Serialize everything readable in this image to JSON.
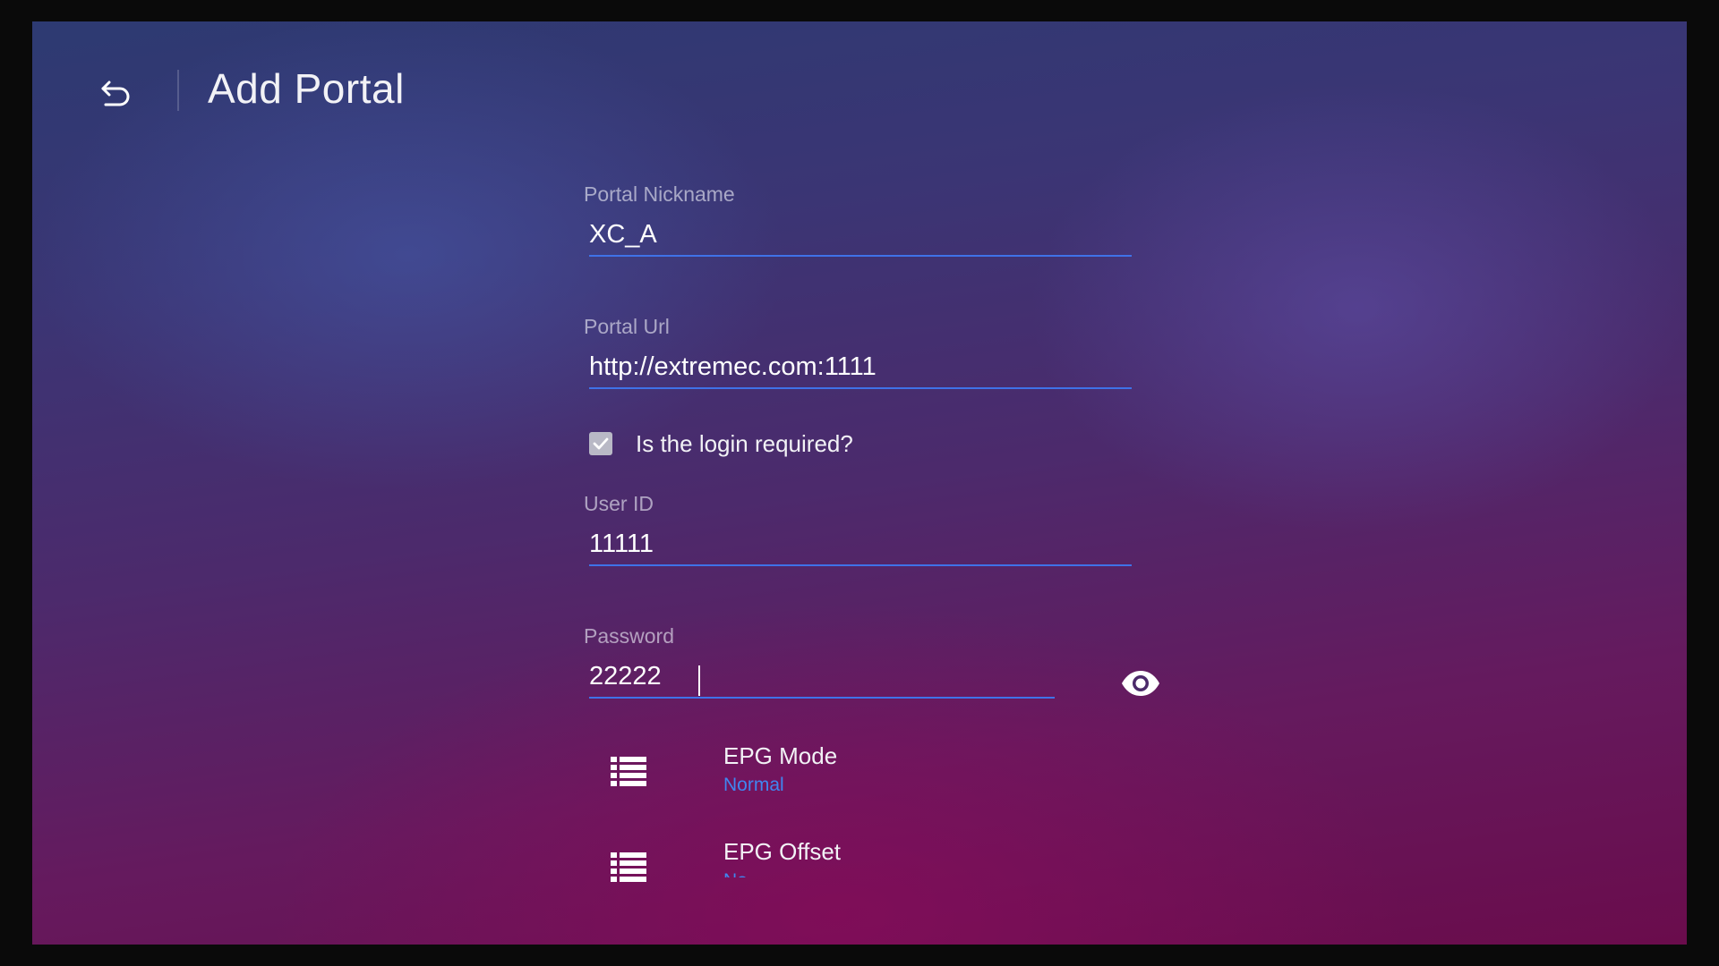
{
  "header": {
    "title": "Add Portal"
  },
  "form": {
    "nickname": {
      "label": "Portal Nickname",
      "value": "XC_A"
    },
    "url": {
      "label": "Portal Url",
      "value": "http://extremec.com:1111"
    },
    "login_required": {
      "label": "Is the login required?",
      "checked": true
    },
    "user_id": {
      "label": "User ID",
      "value": "11111"
    },
    "password": {
      "label": "Password",
      "value": "22222"
    }
  },
  "settings": {
    "epg_mode": {
      "title": "EPG Mode",
      "value": "Normal"
    },
    "epg_offset": {
      "title": "EPG Offset",
      "value": "No"
    }
  },
  "colors": {
    "accent": "#3f72e8",
    "value_blue": "#3f86f0",
    "checkbox_bg": "#b9b9c6"
  }
}
